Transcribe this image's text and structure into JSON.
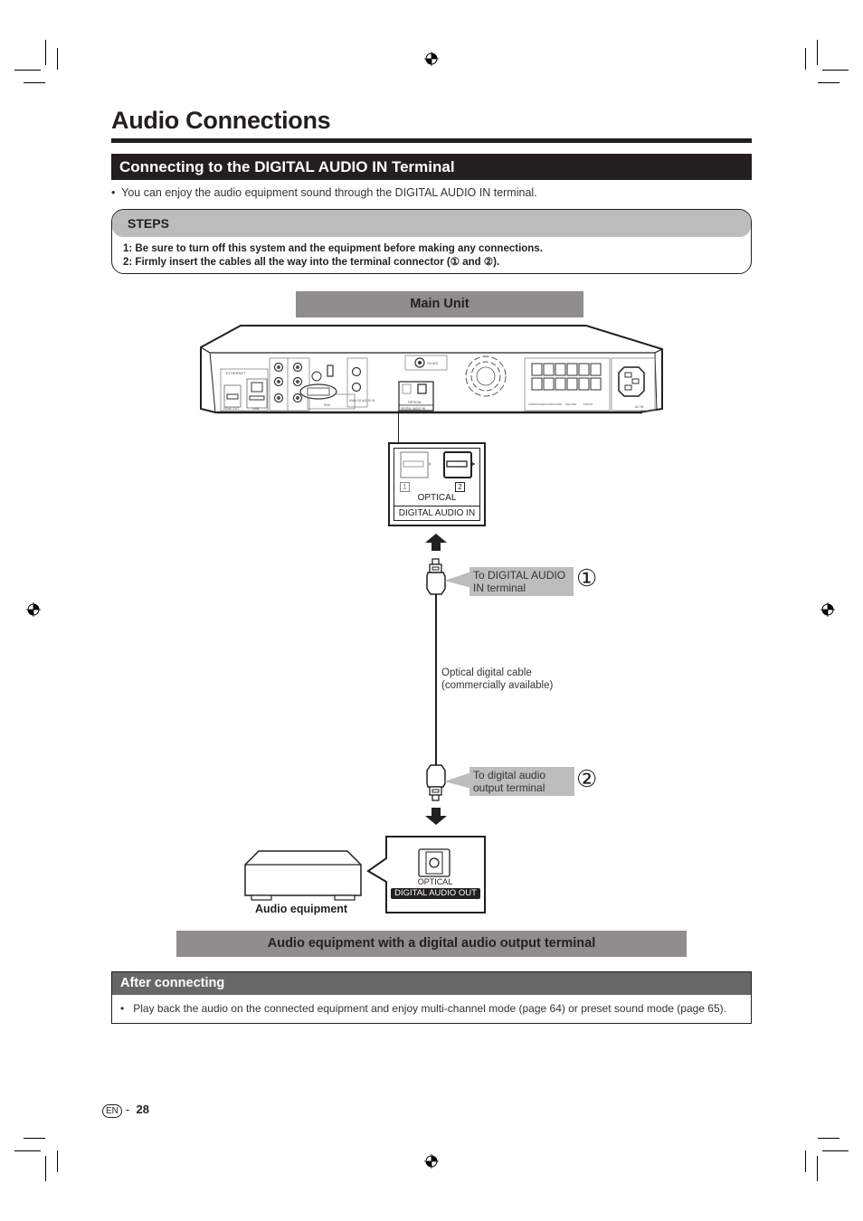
{
  "page": {
    "title": "Audio Connections",
    "section_title": "Connecting to the DIGITAL AUDIO IN Terminal",
    "intro_bullet": "You can enjoy the audio equipment sound through the DIGITAL AUDIO IN terminal.",
    "bullet_char": "•"
  },
  "steps": {
    "heading": "STEPS",
    "items": [
      "1: Be sure to turn off this system and the equipment before making any connections.",
      "2: Firmly insert the cables all the way into the terminal connector (① and ②)."
    ]
  },
  "diagram": {
    "main_unit_label": "Main Unit",
    "rear_panel": {
      "labels": {
        "ethernet": "ETHERNET",
        "hdmi_out": "HDMI OUT",
        "usb": "USB",
        "component": "COMPONENT VIDEO OUT",
        "video": "VIDEO",
        "audio_out": "AUDIO OUT",
        "ipod": "iPod",
        "analog_in": "ANALOG AUDIO IN",
        "fm": "FM ANT",
        "optical": "OPTICAL",
        "digital_audio_in": "DIGITAL AUDIO IN",
        "subwoofer": "SUBWOOFER",
        "surround": "SURROUND",
        "center": "CENTER",
        "front": "FRONT",
        "ac_in": "AC IN"
      }
    },
    "closeup_in": {
      "port_1": "1",
      "port_2": "2",
      "optical_label": "OPTICAL",
      "terminal_label": "DIGITAL AUDIO IN"
    },
    "callout_1": {
      "text_line1": "To DIGITAL AUDIO",
      "text_line2": "IN terminal",
      "number": "①"
    },
    "cable": {
      "line1": "Optical digital cable",
      "line2": "(commercially available)"
    },
    "callout_2": {
      "text_line1": "To digital audio",
      "text_line2": "output terminal",
      "number": "②"
    },
    "closeup_out": {
      "optical_label": "OPTICAL",
      "terminal_label": "DIGITAL AUDIO OUT"
    },
    "audio_equipment_label": "Audio equipment",
    "bottom_label": "Audio equipment with a digital audio output terminal"
  },
  "after": {
    "heading": "After connecting",
    "bullet": "Play back the audio on the connected equipment and enjoy multi-channel mode (page 64) or preset sound mode (page 65)."
  },
  "footer": {
    "lang_badge": "EN",
    "separator": "-",
    "page_number": "28"
  }
}
